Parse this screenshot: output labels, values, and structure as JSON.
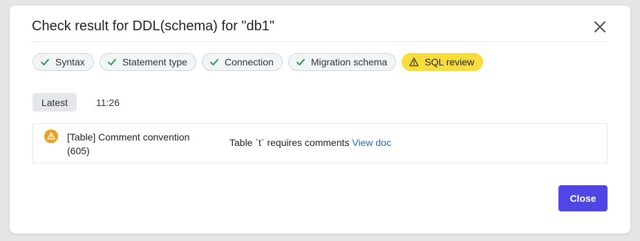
{
  "dialog": {
    "title": "Check result for DDL(schema) for \"db1\""
  },
  "checks": [
    {
      "label": "Syntax",
      "status": "success"
    },
    {
      "label": "Statement type",
      "status": "success"
    },
    {
      "label": "Connection",
      "status": "success"
    },
    {
      "label": "Migration schema",
      "status": "success"
    },
    {
      "label": "SQL review",
      "status": "warning"
    }
  ],
  "history": {
    "latest_label": "Latest",
    "time": "11:26"
  },
  "results": [
    {
      "icon": "warning-icon",
      "title": "[Table] Comment convention (605)",
      "message": "Table `t` requires comments",
      "link_text": "View doc"
    }
  ],
  "footer": {
    "close_label": "Close"
  },
  "colors": {
    "accent": "#4f46e5",
    "warning_chip": "#f8db3c",
    "warning_icon": "#f0a020",
    "success_check": "#1f8f4a",
    "link": "#1e6bb8"
  }
}
